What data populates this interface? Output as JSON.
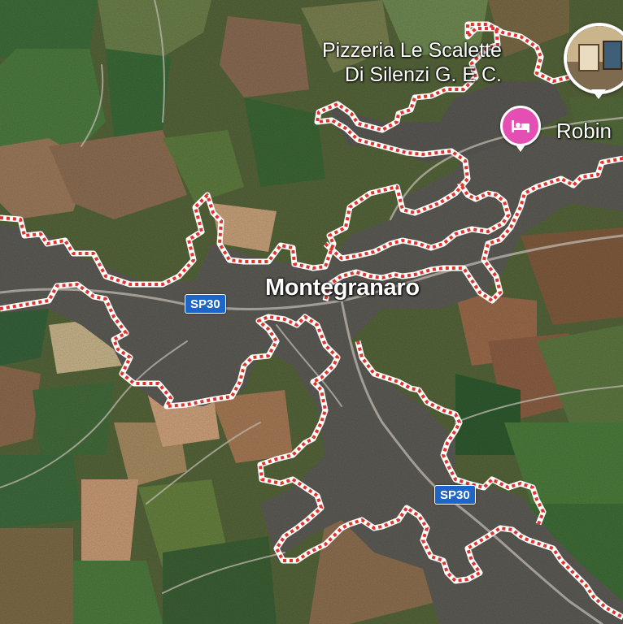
{
  "map": {
    "place_label": "Montegranaro",
    "road_shields": [
      "SP30",
      "SP30"
    ],
    "pois": {
      "pizzeria_line1": "Pizzeria Le Scalette",
      "pizzeria_line2": "Di Silenzi G. E C.",
      "hotel_label": "Robin"
    },
    "icons": {
      "hotel": "bed-icon",
      "photo_marker": "place-photo-icon"
    },
    "colors": {
      "boundary_outer": "#ffffff",
      "boundary_dash": "#e0342b",
      "road_shield": "#1d66c8",
      "hotel_pin": "#e54fb3"
    }
  }
}
